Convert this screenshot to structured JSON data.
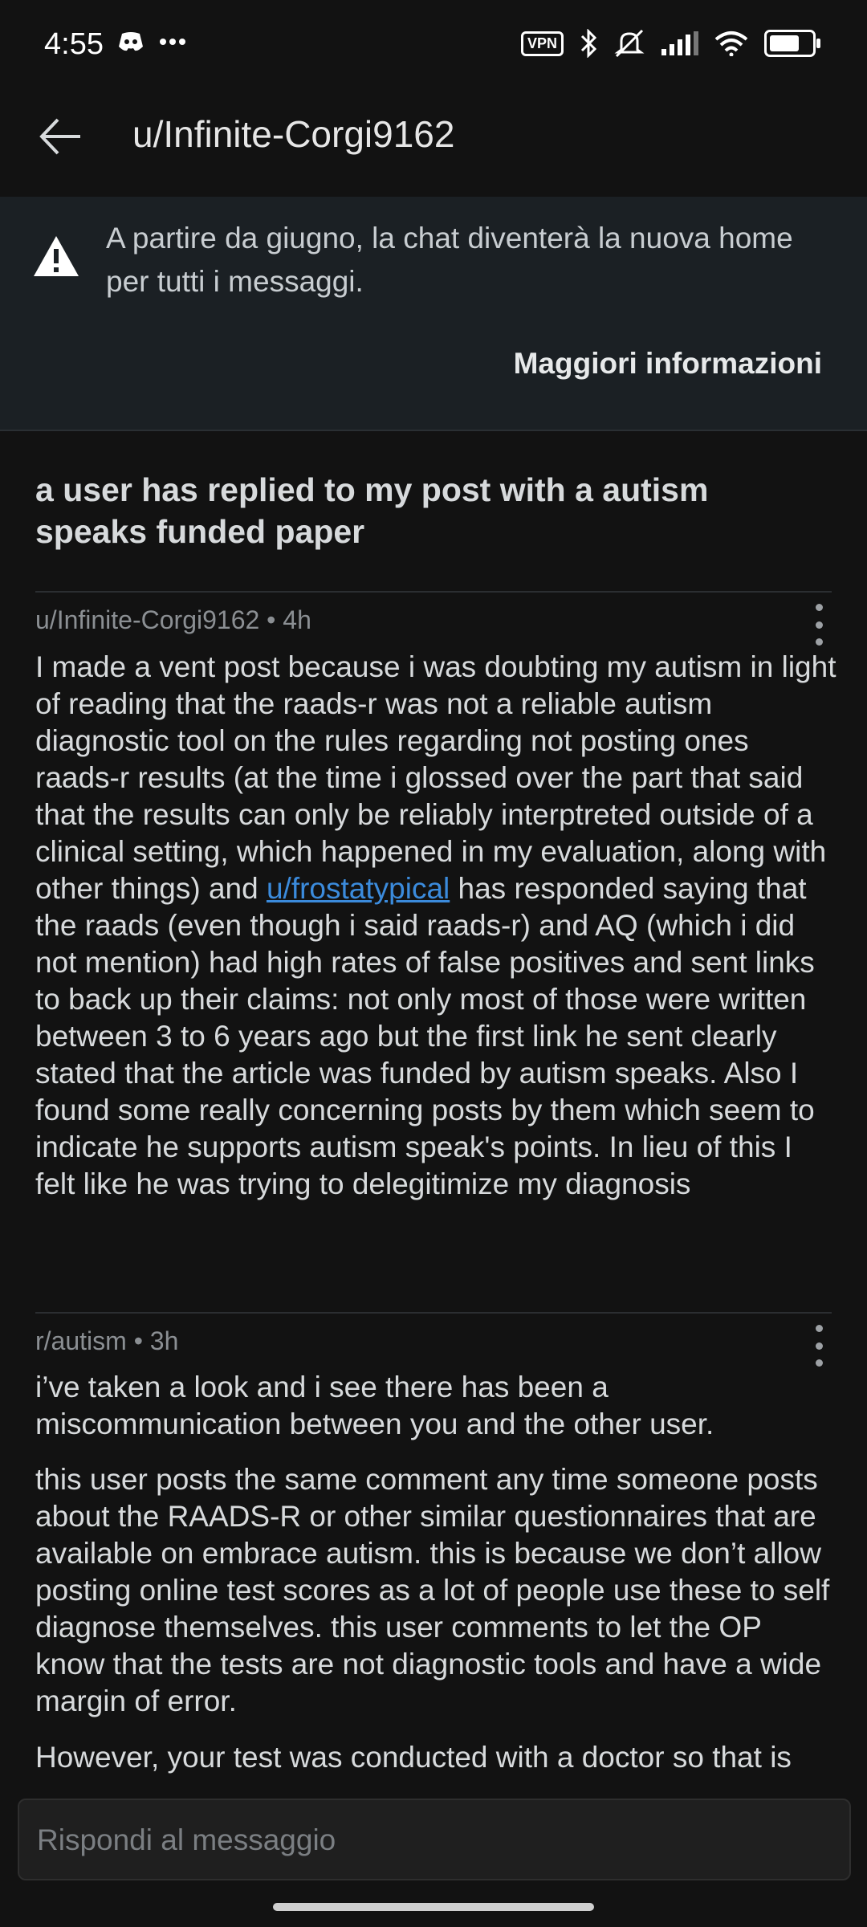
{
  "status_bar": {
    "time": "4:55",
    "icons": [
      "discord-icon",
      "more-dots-icon",
      "vpn-icon",
      "bluetooth-icon",
      "mute-icon",
      "signal-icon",
      "wifi-icon",
      "battery-icon"
    ],
    "vpn_label": "VPN"
  },
  "header": {
    "title": "u/Infinite-Corgi9162"
  },
  "banner": {
    "text": "A partire da giugno, la chat diventerà la nuova home per tutti i messaggi.",
    "link": "Maggiori informazioni"
  },
  "thread": {
    "subject": "a user has replied to my post with a autism speaks funded paper"
  },
  "messages": [
    {
      "author": "u/Infinite-Corgi9162",
      "time": "4h",
      "body_before_link": "I made a vent post because i was doubting my autism in light of reading that the raads-r was not a reliable autism diagnostic tool on the rules regarding not posting ones raads-r results (at the time i glossed over the part that said that the results can only be reliably interptreted outside of a clinical setting, which happened in my evaluation, along with other things) and ",
      "link": "u/frostatypical",
      "body_after_link": " has responded saying that the raads (even though i said raads-r) and AQ (which i did not mention) had high rates of false positives and sent links to back up their claims: not only most of those were written between 3 to 6 years ago but the first link he sent clearly stated that the article was funded by autism speaks. Also I found some really concerning posts by them which seem to indicate he supports autism speak's points. In lieu of this I felt like he was trying to delegitimize my diagnosis"
    },
    {
      "author": "r/autism",
      "time": "3h",
      "paragraphs": [
        "i’ve taken a look and i see there has been a miscommunication between you and the other user.",
        "this user posts the same comment any time someone posts about the RAADS-R or other similar questionnaires that are available on embrace autism. this is because we don’t allow posting online test scores as a lot of people use these to self diagnose themselves. this user comments to let the OP know that the tests are not diagnostic tools and have a wide margin of error.",
        "However, your test was conducted with a doctor so that is different. the resources in your post included in"
      ]
    }
  ],
  "reply": {
    "placeholder": "Rispondi al messaggio"
  },
  "colors": {
    "background": "#121212",
    "banner": "#1b2024",
    "link": "#3b8bdc",
    "text": "#d7dadc",
    "meta": "#8b8f93"
  }
}
